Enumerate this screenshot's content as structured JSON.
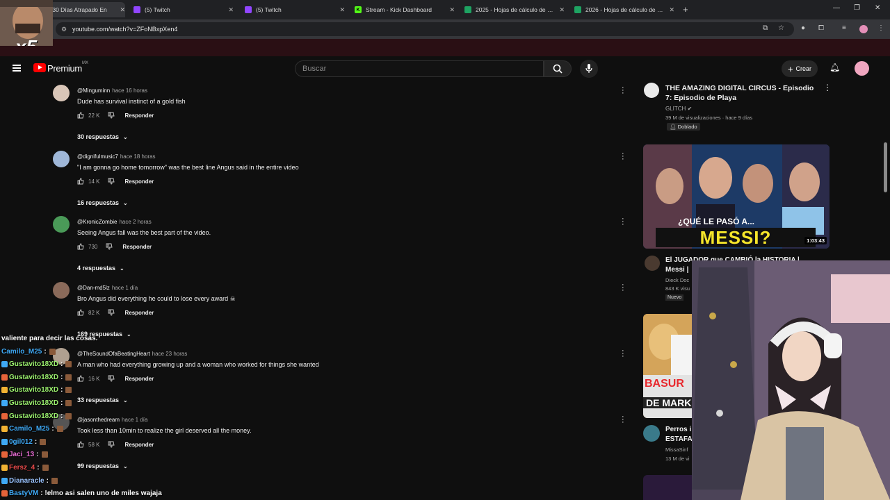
{
  "browser": {
    "tabs": [
      {
        "label": "ve 30 Días Atrapado En",
        "icon": "youtube-icon",
        "active": true
      },
      {
        "label": "(5) Twitch",
        "icon": "twitch-icon"
      },
      {
        "label": "(5) Twitch",
        "icon": "twitch-icon"
      },
      {
        "label": "Stream - Kick Dashboard",
        "icon": "kick-icon"
      },
      {
        "label": "2025 - Hojas de cálculo de Goo",
        "icon": "sheets-icon"
      },
      {
        "label": "2026 - Hojas de cálculo de Goo",
        "icon": "sheets-icon"
      }
    ],
    "url": "youtube.com/watch?v=ZFoNBxpXen4"
  },
  "header": {
    "brand": "Premium",
    "region": "MX",
    "search_placeholder": "Buscar",
    "create_label": "Crear"
  },
  "comments": [
    {
      "author": "@Minguminn",
      "time": "hace 16 horas",
      "text": "Dude has survival instinct of a gold fish",
      "likes": "22 K",
      "reply": "Responder",
      "replies": "30 respuestas",
      "avatar_color": "#d9c6b8"
    },
    {
      "author": "@dignifulmusic7",
      "time": "hace 18 horas",
      "text": "\"I am gonna go home tomorrow\" was the best line Angus said in the entire video",
      "likes": "14 K",
      "reply": "Responder",
      "replies": "16 respuestas",
      "avatar_color": "#9fb7d8"
    },
    {
      "author": "@KronicZombie",
      "time": "hace 2 horas",
      "text": "Seeing Angus fall was the best part of the video.",
      "likes": "730",
      "reply": "Responder",
      "replies": "4 respuestas",
      "avatar_color": "#4a9a58"
    },
    {
      "author": "@Dan-md5lz",
      "time": "hace 1 día",
      "text": "Bro Angus did everything he could to lose every award ☠",
      "likes": "82 K",
      "reply": "Responder",
      "replies": "169 respuestas",
      "avatar_color": "#8a6a5a"
    },
    {
      "author": "@TheSoundOfaBeatingHeart",
      "time": "hace 23 horas",
      "text": "A man who had everything growing up and a woman who worked for things she wanted",
      "likes": "16 K",
      "reply": "Responder",
      "replies": "33 respuestas",
      "avatar_color": "#b0a090"
    },
    {
      "author": "@jasonthedream",
      "time": "hace 1 día",
      "text": "Took less than 10min to realize the girl deserved all the money.",
      "likes": "58 K",
      "reply": "Responder",
      "replies": "99 respuestas",
      "avatar_color": "#555555"
    }
  ],
  "sidebar": {
    "first": {
      "title": "THE AMAZING DIGITAL CIRCUS - Episodio 7: Episodio de Playa",
      "channel": "GLITCH",
      "stats": "39 M de visualizaciones · hace 9 días",
      "badge": "Doblado"
    },
    "thumb_text": "¿QUÉ LE PASÓ A...",
    "thumb_big": "MESSI?",
    "thumb_duration": "1:03:43",
    "second": {
      "title_line1": "El JUGADOR que CAMBIÓ la HISTORIA |",
      "title_line2": "Messi |",
      "channel": "Dieck Doc",
      "stats": "843 K visu",
      "badge": "Nuevo"
    },
    "third_thumb_line1": "BASUR",
    "third_thumb_line2": "DE MARK",
    "fourth": {
      "title_line1": "Perros i",
      "title_line2": "ESTAFA",
      "channel": "MissaSinf",
      "stats": "13 M de vi"
    }
  },
  "overlay": {
    "multiplier": "x5"
  },
  "chat": [
    {
      "user": "",
      "text": "valiente para decir las cosas.",
      "color": "#ffffff"
    },
    {
      "user": "Camilo_M25",
      "text": ":",
      "color": "#3fa9f5"
    },
    {
      "user": "Gustavito18XD",
      "text": ":",
      "color": "#9bf06e"
    },
    {
      "user": "Gustavito18XD",
      "text": ":",
      "color": "#9bf06e"
    },
    {
      "user": "Gustavito18XD",
      "text": ":",
      "color": "#9bf06e"
    },
    {
      "user": "Gustavito18XD",
      "text": ":",
      "color": "#9bf06e"
    },
    {
      "user": "Gustavito18XD",
      "text": ":",
      "color": "#9bf06e"
    },
    {
      "user": "Camilo_M25",
      "text": ":",
      "color": "#3fa9f5"
    },
    {
      "user": "0gil012",
      "text": ":",
      "color": "#3fa9f5"
    },
    {
      "user": "Jaci_13",
      "text": ":",
      "color": "#e86cd4"
    },
    {
      "user": "Fersz_4",
      "text": ":",
      "color": "#e84a4a"
    },
    {
      "user": "Dianaracle",
      "text": ":",
      "color": "#9bc4ff"
    },
    {
      "user": "BastyVM",
      "text": ": !elmo asi salen uno de miles wajaja",
      "color": "#3fa9f5"
    }
  ]
}
